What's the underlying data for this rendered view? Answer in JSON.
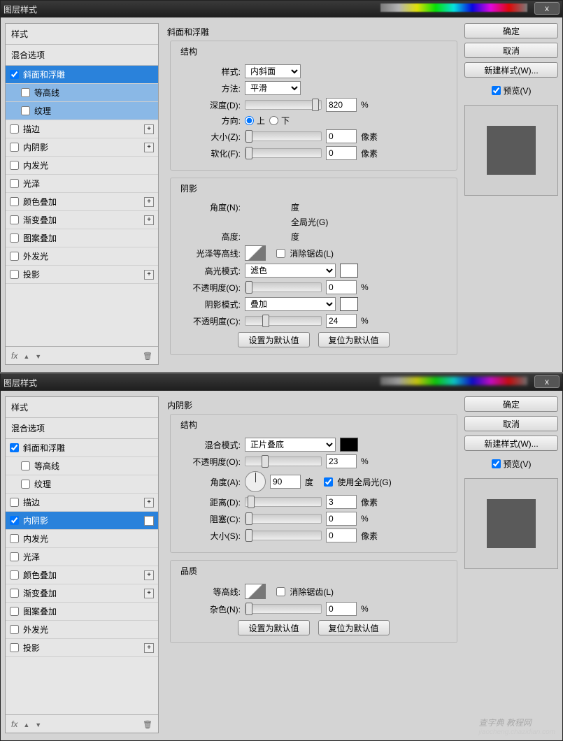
{
  "common": {
    "window_title": "图层样式",
    "close_x": "x",
    "styles_header": "样式",
    "blend_options": "混合选项",
    "effects": {
      "bevel": "斜面和浮雕",
      "contour": "等高线",
      "texture": "纹理",
      "stroke": "描边",
      "inner_shadow": "内阴影",
      "inner_glow": "内发光",
      "satin": "光泽",
      "color_overlay": "颜色叠加",
      "grad_overlay": "渐变叠加",
      "pattern_overlay": "图案叠加",
      "outer_glow": "外发光",
      "drop_shadow": "投影"
    },
    "fx_label": "fx",
    "plus": "+",
    "right": {
      "ok": "确定",
      "cancel": "取消",
      "new_style": "新建样式(W)...",
      "preview": "预览(V)"
    },
    "btns": {
      "set_default": "设置为默认值",
      "reset_default": "复位为默认值"
    }
  },
  "top": {
    "panel_title": "斜面和浮雕",
    "struct": "结构",
    "style_lbl": "样式:",
    "style_val": "内斜面",
    "method_lbl": "方法:",
    "method_val": "平滑",
    "depth_lbl": "深度(D):",
    "depth_val": "820",
    "pct": "%",
    "direction_lbl": "方向:",
    "dir_up": "上",
    "dir_down": "下",
    "size_lbl": "大小(Z):",
    "size_val": "0",
    "px": "像素",
    "soften_lbl": "软化(F):",
    "soften_val": "0",
    "shade": "阴影",
    "angle_lbl": "角度(N):",
    "deg": "度",
    "global": "全局光(G)",
    "altitude_lbl": "高度:",
    "alt_unit": "度",
    "gloss_lbl": "光泽等高线:",
    "antialias": "消除锯齿(L)",
    "hi_mode_lbl": "高光模式:",
    "hi_mode_val": "滤色",
    "hi_op_lbl": "不透明度(O):",
    "hi_op_val": "0",
    "sh_mode_lbl": "阴影模式:",
    "sh_mode_val": "叠加",
    "sh_op_lbl": "不透明度(C):",
    "sh_op_val": "24"
  },
  "bottom": {
    "panel_title": "内阴影",
    "struct": "结构",
    "blend_lbl": "混合模式:",
    "blend_val": "正片叠底",
    "op_lbl": "不透明度(O):",
    "op_val": "23",
    "pct": "%",
    "angle_lbl": "角度(A):",
    "angle_val": "90",
    "deg": "度",
    "global": "使用全局光(G)",
    "dist_lbl": "距离(D):",
    "dist_val": "3",
    "px": "像素",
    "choke_lbl": "阻塞(C):",
    "choke_val": "0",
    "size_lbl": "大小(S):",
    "size_val": "0",
    "quality": "品质",
    "contour_lbl": "等高线:",
    "antialias": "消除锯齿(L)",
    "noise_lbl": "杂色(N):",
    "noise_val": "0"
  },
  "watermark": {
    "l1": "查字典 教程网",
    "l2": "jiaocheng.chazidian.com"
  }
}
